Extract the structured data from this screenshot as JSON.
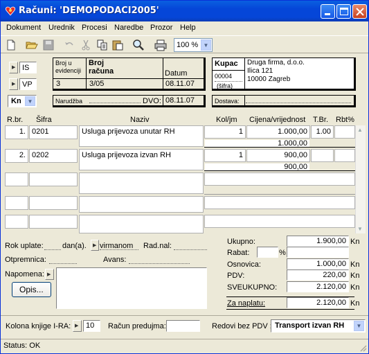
{
  "window": {
    "title": "Računi: 'DEMOPODACI2005'"
  },
  "menu": [
    "Dokument",
    "Urednik",
    "Procesi",
    "Naredbe",
    "Prozor",
    "Help"
  ],
  "toolbar": {
    "zoom": "100 %"
  },
  "header": {
    "type1": "IS",
    "type2": "VP",
    "currency": "Kn",
    "broj_evidencije_label": "Broj u evidenciji",
    "broj_racuna_label": "Broj računa",
    "datum_label": "Datum",
    "broj_evidencije": "3",
    "broj_racuna": "3/05",
    "datum": "08.11.07",
    "narudzba_label": "Narudžba",
    "dvo_label": "DVO:",
    "dvo": "08.11.07",
    "kupac_label": "Kupac",
    "kupac_sifra": "00004",
    "sifra_label": "(šifra)",
    "kupac_lines": [
      "Druga firma, d.o.o.",
      "Ilica 121",
      "10000 Zagreb"
    ],
    "dostava_label": "Dostava:"
  },
  "items_header": {
    "rbr": "R.br.",
    "sifra": "Šifra",
    "naziv": "Naziv",
    "kol": "Kol/jm",
    "cijena": "Cijena/vrijednost",
    "tbr": "T.Br.",
    "rbt": "Rbt%"
  },
  "items": [
    {
      "rbr": "1.",
      "sifra": "0201",
      "naziv": "Usluga prijevoza unutar RH",
      "kol": "1",
      "cijena": "1.000,00",
      "tbr": "1.00",
      "vrijednost": "1.000,00"
    },
    {
      "rbr": "2.",
      "sifra": "0202",
      "naziv": "Usluga prijevoza izvan RH",
      "kol": "1",
      "cijena": "900,00",
      "tbr": "",
      "vrijednost": "900,00"
    }
  ],
  "footer": {
    "rok_uplate": "Rok uplate:",
    "dana": "dan(a).",
    "virmanom": "virmanom",
    "rad_nal": "Rad.nal:",
    "otpremnica": "Otpremnica:",
    "avans": "Avans:",
    "napomena": "Napomena:",
    "opis": "Opis...",
    "ukupno_label": "Ukupno:",
    "ukupno": "1.900,00",
    "rabat_label": "Rabat:",
    "pct": "%",
    "osnovica_label": "Osnovica:",
    "osnovica": "1.000,00",
    "pdv_label": "PDV:",
    "pdv": "220,00",
    "sveukupno_label": "SVEUKUPNO:",
    "sveukupno": "2.120,00",
    "za_naplatu_label": "Za naplatu:",
    "za_naplatu": "2.120,00",
    "kn": "Kn"
  },
  "bottom": {
    "kolona_label": "Kolona knjige I-RA:",
    "kolona": "10",
    "racun_predujma": "Račun predujma:",
    "redovi_label": "Redovi bez PDV :",
    "redovi_value": "Transport izvan RH"
  },
  "status": "Status: OK"
}
